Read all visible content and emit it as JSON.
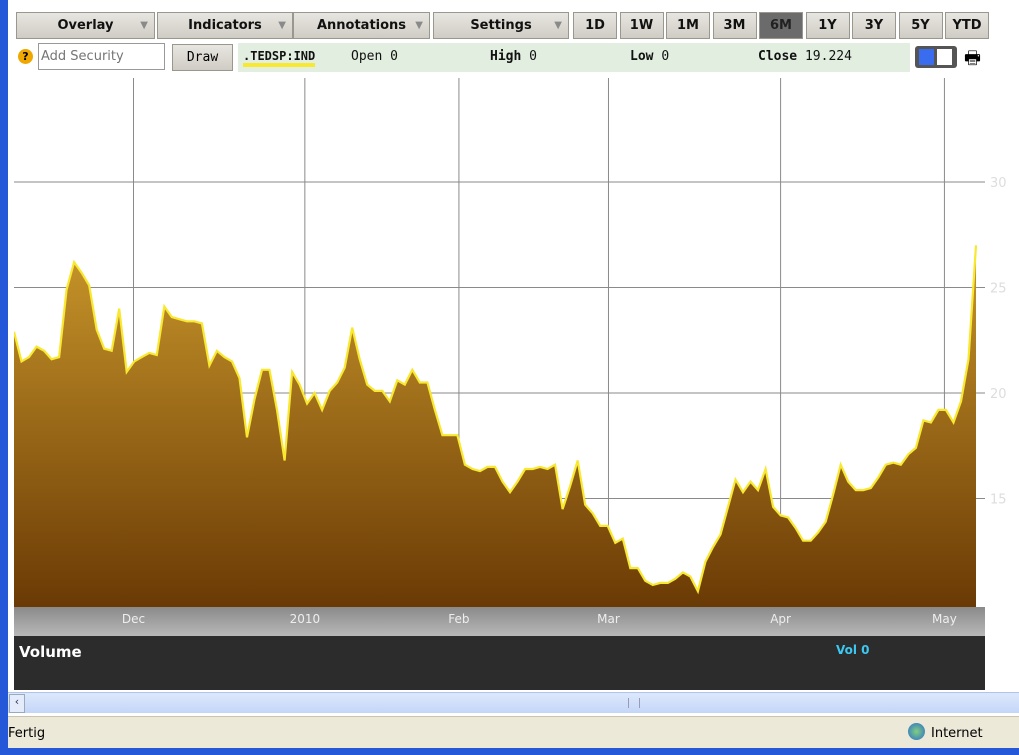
{
  "toolbar": {
    "menus": [
      "Overlay",
      "Indicators",
      "Annotations",
      "Settings"
    ],
    "ranges": [
      "1D",
      "1W",
      "1M",
      "3M",
      "6M",
      "1Y",
      "3Y",
      "5Y",
      "YTD"
    ],
    "active_range": "6M"
  },
  "security_bar": {
    "help": "?",
    "add_placeholder": "Add Security",
    "draw": "Draw",
    "symbol": ".TEDSP:IND",
    "open_label": "Open",
    "open": "0",
    "high_label": "High",
    "high": "0",
    "low_label": "Low",
    "low": "0",
    "close_label": "Close",
    "close": "19.224"
  },
  "volume": {
    "title": "Volume",
    "value": "Vol 0"
  },
  "status": {
    "text": "Fertig",
    "zone": "Internet"
  },
  "colors": {
    "line": "#f8e830",
    "fill_top": "#c8962a",
    "fill_bottom": "#6a3a05",
    "accent": "#3cc8f0"
  },
  "chart_data": {
    "type": "area",
    "title": ".TEDSP:IND",
    "ylim": [
      10,
      35
    ],
    "yticks": [
      15,
      20,
      25,
      30
    ],
    "xticks": [
      {
        "label": "Dec",
        "index": 15.9
      },
      {
        "label": "2010",
        "index": 38.7
      },
      {
        "label": "Feb",
        "index": 59.2
      },
      {
        "label": "Mar",
        "index": 79.1
      },
      {
        "label": "Apr",
        "index": 102
      },
      {
        "label": "May",
        "index": 123.8
      }
    ],
    "values": [
      22.9,
      21.5,
      21.7,
      22.2,
      22.0,
      21.6,
      21.7,
      24.9,
      26.2,
      25.7,
      25.1,
      23.0,
      22.1,
      22.0,
      24.0,
      21.0,
      21.5,
      21.7,
      21.9,
      21.8,
      24.1,
      23.6,
      23.5,
      23.4,
      23.4,
      23.3,
      21.3,
      22.0,
      21.7,
      21.5,
      20.7,
      17.9,
      19.7,
      21.1,
      21.1,
      19.2,
      16.8,
      21.0,
      20.4,
      19.5,
      20.0,
      19.2,
      20.1,
      20.5,
      21.2,
      23.1,
      21.6,
      20.4,
      20.1,
      20.1,
      19.6,
      20.6,
      20.4,
      21.1,
      20.5,
      20.5,
      19.2,
      18.0,
      18.0,
      18.0,
      16.6,
      16.4,
      16.3,
      16.5,
      16.5,
      15.8,
      15.3,
      15.8,
      16.4,
      16.4,
      16.5,
      16.4,
      16.6,
      14.5,
      15.6,
      16.8,
      14.7,
      14.3,
      13.7,
      13.7,
      12.9,
      13.1,
      11.7,
      11.7,
      11.1,
      10.9,
      11.0,
      11.0,
      11.2,
      11.5,
      11.3,
      10.6,
      12.0,
      12.7,
      13.3,
      14.6,
      15.9,
      15.3,
      15.8,
      15.4,
      16.4,
      14.6,
      14.2,
      14.1,
      13.6,
      13.0,
      13.0,
      13.4,
      13.9,
      15.2,
      16.6,
      15.8,
      15.4,
      15.4,
      15.5,
      16.0,
      16.6,
      16.7,
      16.6,
      17.1,
      17.4,
      18.7,
      18.6,
      19.2,
      19.2,
      18.6,
      19.6,
      21.6,
      27.0
    ]
  }
}
